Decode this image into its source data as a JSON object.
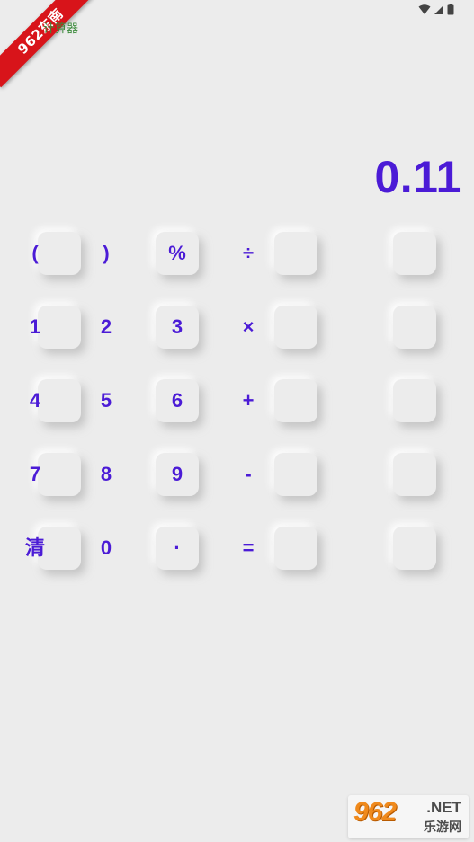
{
  "app": {
    "title": "计算器",
    "corner_badge": "962东南",
    "display_value": "0.11"
  },
  "status_bar": {
    "icons": [
      "wifi-icon",
      "signal-icon",
      "battery-icon"
    ]
  },
  "keypad": {
    "rows": [
      [
        "(",
        ")",
        "%",
        "÷"
      ],
      [
        "1",
        "2",
        "3",
        "×"
      ],
      [
        "4",
        "5",
        "6",
        "+"
      ],
      [
        "7",
        "8",
        "9",
        "-"
      ],
      [
        "清",
        "0",
        "·",
        "="
      ]
    ]
  },
  "watermark": {
    "logo_main": "962",
    "logo_net": ".NET",
    "logo_sub": "乐游网"
  },
  "colors": {
    "accent": "#4b1bd6",
    "background": "#ececec",
    "title_green": "#3b8a3b",
    "badge_red": "#d8141a",
    "logo_orange": "#f08a1c"
  }
}
